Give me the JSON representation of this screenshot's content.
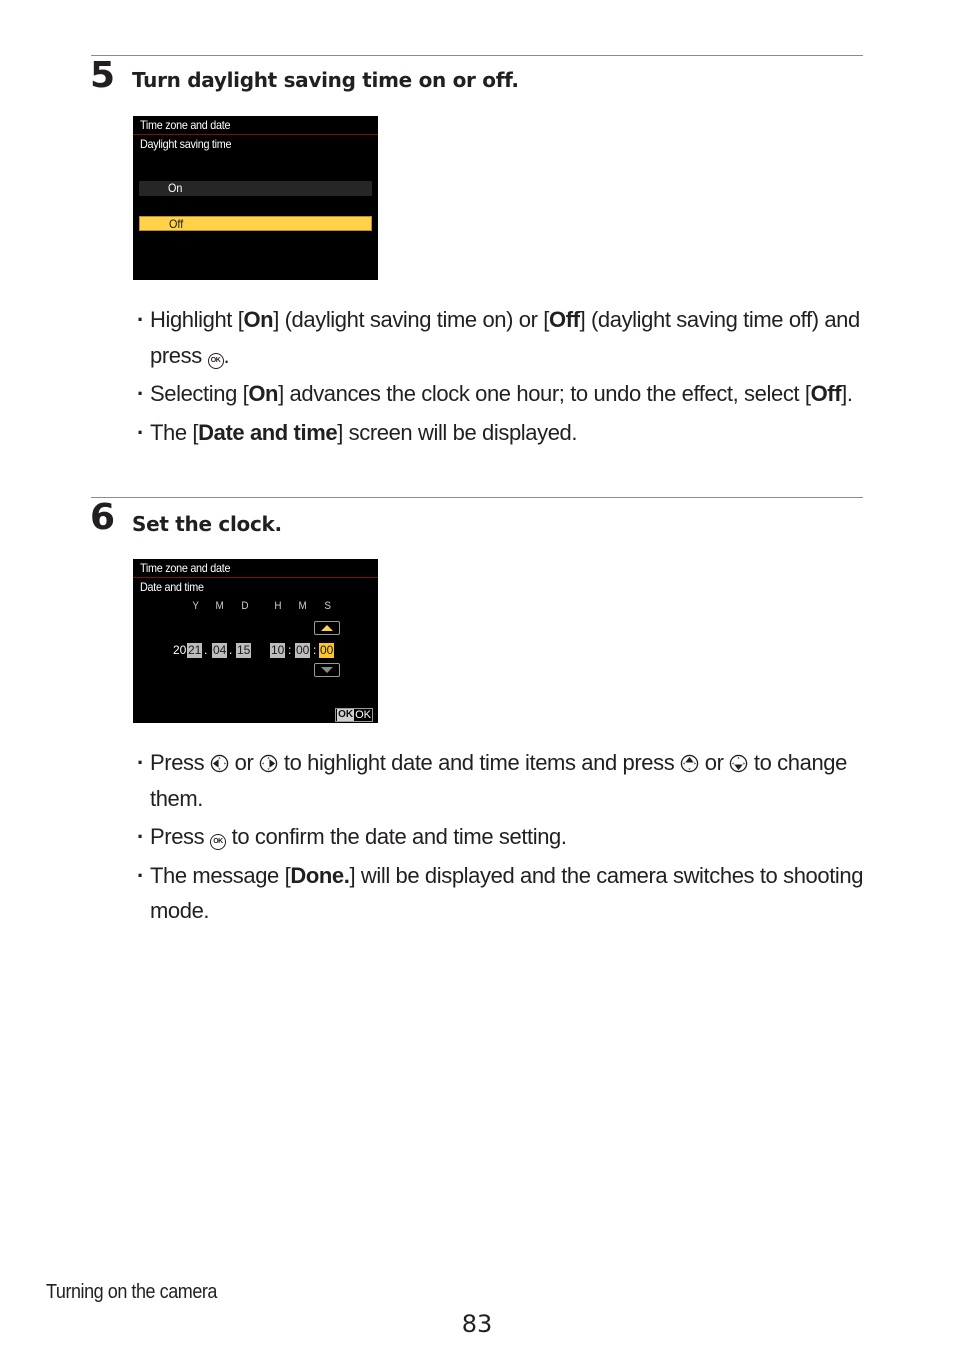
{
  "step5": {
    "number": "5",
    "title": "Turn daylight saving time on or off.",
    "screen": {
      "title": "Time zone and date",
      "subtitle": "Daylight saving time",
      "options": [
        {
          "label": "On",
          "selected": false
        },
        {
          "label": "Off",
          "selected": true
        }
      ],
      "accent_color": "#ffd24a"
    },
    "bullets": [
      {
        "parts": [
          {
            "t": "Highlight ["
          },
          {
            "t": "On",
            "b": true
          },
          {
            "t": "] (daylight saving time on) or ["
          },
          {
            "t": "Off",
            "b": true
          },
          {
            "t": "] (daylight saving time off) and press "
          },
          {
            "icon": "ok-button-icon",
            "glyph": "OK"
          },
          {
            "t": "."
          }
        ]
      },
      {
        "parts": [
          {
            "t": "Selecting ["
          },
          {
            "t": "On",
            "b": true
          },
          {
            "t": "] advances the clock one hour; to undo the effect, select ["
          },
          {
            "t": "Off",
            "b": true
          },
          {
            "t": "]."
          }
        ]
      },
      {
        "parts": [
          {
            "t": "The ["
          },
          {
            "t": "Date and time",
            "b": true
          },
          {
            "t": "] screen will be displayed."
          }
        ]
      }
    ]
  },
  "step6": {
    "number": "6",
    "title": "Set the clock.",
    "screen": {
      "title": "Time zone and date",
      "subtitle": "Date and time",
      "headers": [
        "Y",
        "M",
        "D",
        "H",
        "M",
        "S"
      ],
      "year_prefix": "20",
      "year": "21",
      "month": "04",
      "day": "15",
      "hour": "10",
      "minute": "00",
      "second": "00",
      "date_sep": ".",
      "time_sep": ":",
      "selected_field": "second",
      "ok_label": "OK",
      "ok_badge": "OK"
    },
    "bullets": [
      {
        "parts": [
          {
            "t": "Press "
          },
          {
            "icon": "multi-selector-left-icon",
            "dir": "left"
          },
          {
            "t": " or "
          },
          {
            "icon": "multi-selector-right-icon",
            "dir": "right"
          },
          {
            "t": " to highlight date and time items and press "
          },
          {
            "icon": "multi-selector-up-icon",
            "dir": "up"
          },
          {
            "t": " or "
          },
          {
            "icon": "multi-selector-down-icon",
            "dir": "down"
          },
          {
            "t": " to change them."
          }
        ]
      },
      {
        "parts": [
          {
            "t": "Press "
          },
          {
            "icon": "ok-button-icon",
            "glyph": "OK"
          },
          {
            "t": " to confirm the date and time setting."
          }
        ]
      },
      {
        "parts": [
          {
            "t": "The message ["
          },
          {
            "t": "Done.",
            "b": true
          },
          {
            "t": "] will be displayed and the camera switches to shooting mode."
          }
        ]
      }
    ]
  },
  "footer": {
    "section": "Turning on the camera",
    "page": "83"
  }
}
